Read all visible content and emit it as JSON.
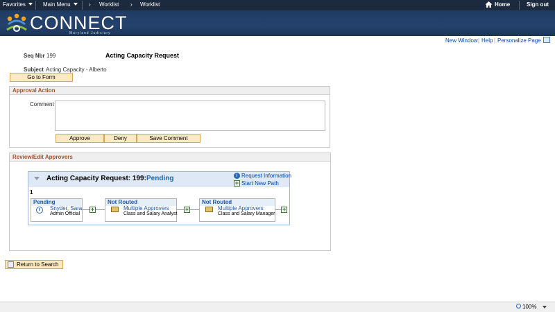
{
  "topnav": {
    "favorites": "Favorites",
    "main_menu": "Main Menu",
    "crumb_worklist_1": "Worklist",
    "crumb_worklist_2": "Worklist",
    "home": "Home",
    "sign_out": "Sign out"
  },
  "banner": {
    "logo_text": "CONNECT",
    "logo_sub": "Maryland Judiciary"
  },
  "page_links": {
    "new_window": "New Window",
    "help": "Help",
    "personalize": "Personalize Page"
  },
  "form": {
    "seq_label": "Seq Nbr",
    "seq_value": "199",
    "title": "Acting Capacity Request",
    "subject_label": "Subject",
    "subject_value": "Acting Capacity - Alberto",
    "go_to_form": "Go to Form"
  },
  "approval_action": {
    "header": "Approval Action",
    "comment_label": "Comment",
    "comment_value": "",
    "approve": "Approve",
    "deny": "Deny",
    "save_comment": "Save Comment"
  },
  "review": {
    "header": "Review/Edit Approvers",
    "map_title": "Acting Capacity Request: 199:",
    "map_status": "Pending",
    "request_information": "Request Information",
    "start_new_path": "Start New Path",
    "path_number": "1",
    "steps": [
      {
        "status": "Pending",
        "name": "Snyder, Sara",
        "role": "Admin Official"
      },
      {
        "status": "Not Routed",
        "name": "Multiple Approvers",
        "role": "Class and Salary Analyst"
      },
      {
        "status": "Not Routed",
        "name": "Multiple Approvers",
        "role": "Class and Salary Manager"
      }
    ]
  },
  "return_to_search": "Return to Search",
  "status_bar": {
    "zoom": "100%"
  },
  "colors": {
    "nav_bg": "#1c2a3f",
    "banner_bg": "#24426d",
    "link": "#0046a8",
    "section_header": "#a0522d",
    "button_bg": "#fde9c0"
  }
}
